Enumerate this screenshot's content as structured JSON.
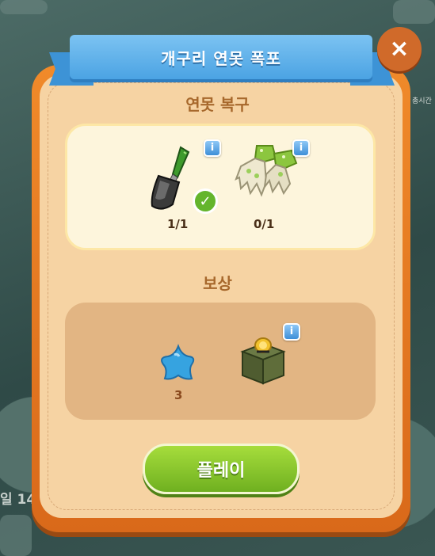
{
  "dialog": {
    "title": "개구리 연못 폭포",
    "close_label": "×"
  },
  "requirements": {
    "heading": "연못 복구",
    "items": [
      {
        "icon": "trowel-icon",
        "count": "1/1",
        "completed": true
      },
      {
        "icon": "gloves-icon",
        "count": "0/1",
        "completed": false
      }
    ]
  },
  "rewards": {
    "heading": "보상",
    "items": [
      {
        "icon": "blue-star-icon",
        "count": "3"
      },
      {
        "icon": "coin-box-icon",
        "count": ""
      }
    ]
  },
  "play_button": {
    "label": "플레이"
  },
  "background": {
    "side_label": "총시간",
    "day_label": "일 14"
  },
  "info_label": "i",
  "check_label": "✓"
}
